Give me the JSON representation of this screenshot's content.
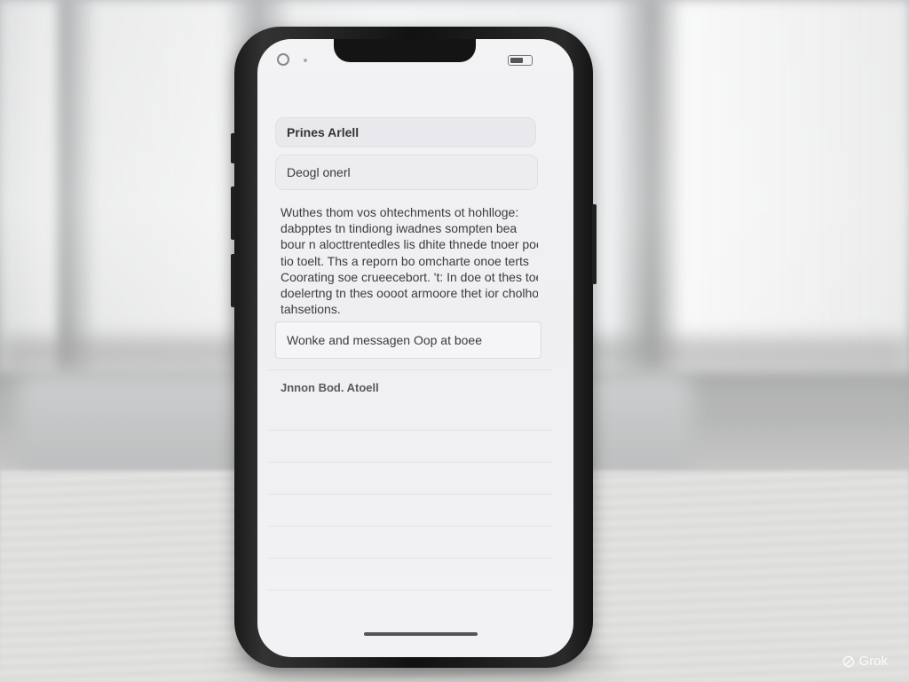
{
  "email": {
    "subject": "Prines Arlell",
    "greeting": "Deogl onerl",
    "body_lines": [
      "Wuthes thom vos ohtechments ot hohlloge:",
      "dabpptes tn tindiong iwadnes sompten bea",
      "bour n alocttrentedles lis dhite thnede tnoer pocy",
      "tio toelt. Ths a reporn bo omcharte onoe terts",
      "Coorating soe crueecebort. 't: In doe ot thes toer bo",
      "doelertng tn thes oooot armoore thet ior cholhog",
      "tahsetions."
    ],
    "reply_field": "Wonke and messagen Oop at boee",
    "sender": "Jnnon Bod. Atoell"
  },
  "watermark": "Grok"
}
